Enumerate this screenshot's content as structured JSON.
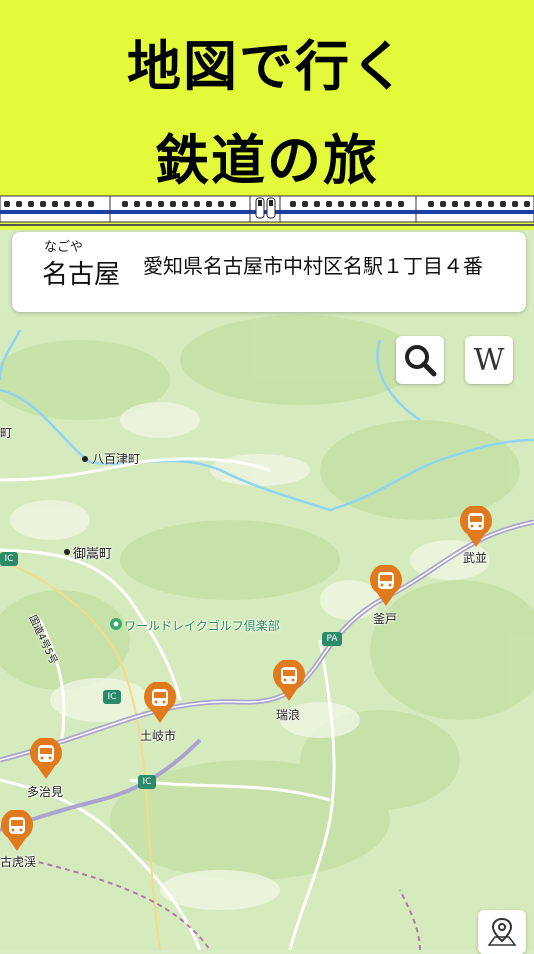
{
  "banner": {
    "title_line1": "地図で行く",
    "title_line2": "鉄道の旅",
    "bg_color": "#e3fa3a"
  },
  "station_card": {
    "furigana": "なごや",
    "name": "名古屋",
    "address": "愛知県名古屋市中村区名駅１丁目４番"
  },
  "map_controls": {
    "search_icon": "magnifier-icon",
    "wiki_label": "W",
    "maps_icon": "map-pin-icon"
  },
  "map_labels": {
    "town1": "八百津町",
    "town2": "御嵩町",
    "golf": "ワールドレイクゴルフ倶楽部",
    "edge_left": "町",
    "road": "国道4号5号"
  },
  "badges": {
    "ic": "IC",
    "pa": "PA"
  },
  "stations": [
    {
      "name": "武並"
    },
    {
      "name": "釜戸"
    },
    {
      "name": "瑞浪"
    },
    {
      "name": "土岐市"
    },
    {
      "name": "多治見"
    },
    {
      "name": "古虎渓"
    }
  ],
  "colors": {
    "pin": "#e07a1c",
    "route": "#a9a3cf",
    "river": "#8fd3f2"
  }
}
